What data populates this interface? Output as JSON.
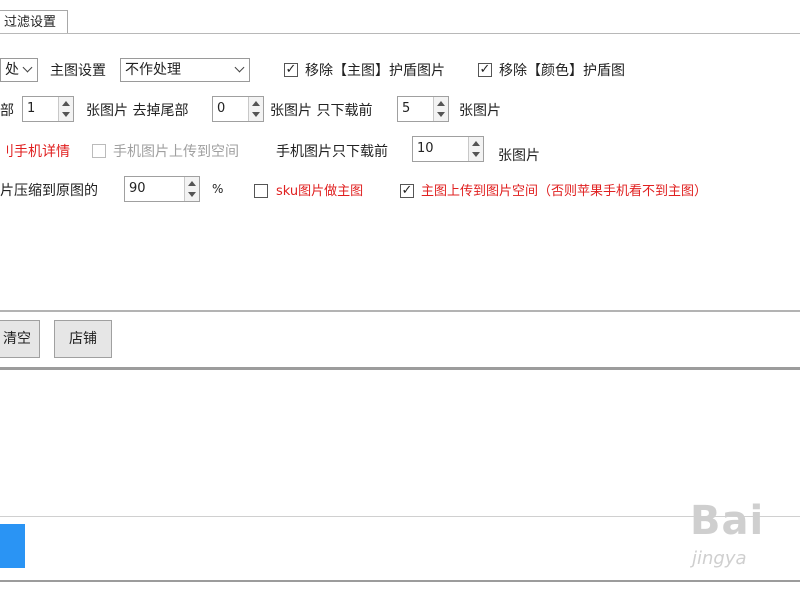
{
  "tab": {
    "label": "过滤设置"
  },
  "row1": {
    "first_select_value": "处",
    "main_setting_label": "主图设置",
    "main_setting_value": "不作处理",
    "remove_main_checked": true,
    "remove_main_label": "移除【主图】护盾图片",
    "remove_color_checked": true,
    "remove_color_label": "移除【颜色】护盾图"
  },
  "row2": {
    "prefix_label": "部",
    "skip_value": "1",
    "skip_suffix": "张图片 去掉尾部",
    "tail_value": "0",
    "tail_suffix": "张图片 只下载前",
    "limit_value": "5",
    "limit_suffix": "张图片"
  },
  "row3": {
    "mobile_detail_label": "刂手机详情",
    "mobile_upload_checked": false,
    "mobile_upload_label": "手机图片上传到空间",
    "mobile_limit_label": "手机图片只下载前",
    "mobile_limit_value": "10",
    "mobile_limit_suffix": "张图片"
  },
  "row4": {
    "compress_label": "片压缩到原图的",
    "compress_value": "90",
    "compress_unit": "%",
    "sku_checked": false,
    "sku_label": "sku图片做主图",
    "upload_main_checked": true,
    "upload_main_label": "主图上传到图片空间（否则苹果手机看不到主图）"
  },
  "buttons": {
    "clear_label": "清空",
    "shop_label": "店铺"
  },
  "watermark": {
    "brand": "Bai",
    "sub": "jingya"
  }
}
